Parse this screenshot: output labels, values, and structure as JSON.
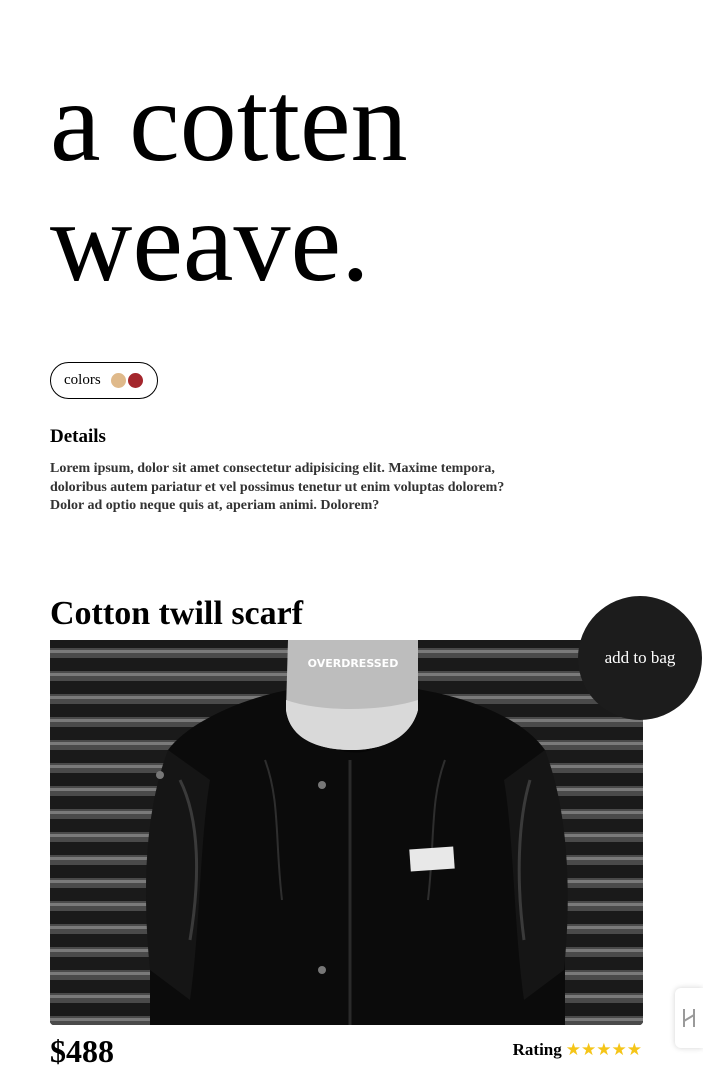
{
  "hero": {
    "title_line1": "a cotten",
    "title_line2": "weave."
  },
  "colors": {
    "label": "colors",
    "swatches": [
      {
        "name": "tan",
        "color": "#dfb98a"
      },
      {
        "name": "red",
        "color": "#a4262c"
      }
    ]
  },
  "details": {
    "heading": "Details",
    "text": "Lorem ipsum, dolor sit amet consectetur adipisicing elit. Maxime tempora, doloribus autem pariatur et vel possimus tenetur ut enim voluptas dolorem? Dolor ad optio neque quis at, aperiam animi. Dolorem?"
  },
  "product": {
    "title": "Cotton twill scarf",
    "add_to_bag_label": "add to bag",
    "price": "$488",
    "rating_label": "Rating",
    "rating_value": 5,
    "rating_max": 5,
    "cap_text": "OVERDRESSED"
  },
  "theme": {
    "button_bg": "#1c1c1c",
    "star_color": "#f5c518"
  },
  "side_widget": {
    "icon": "h-logo-icon"
  }
}
